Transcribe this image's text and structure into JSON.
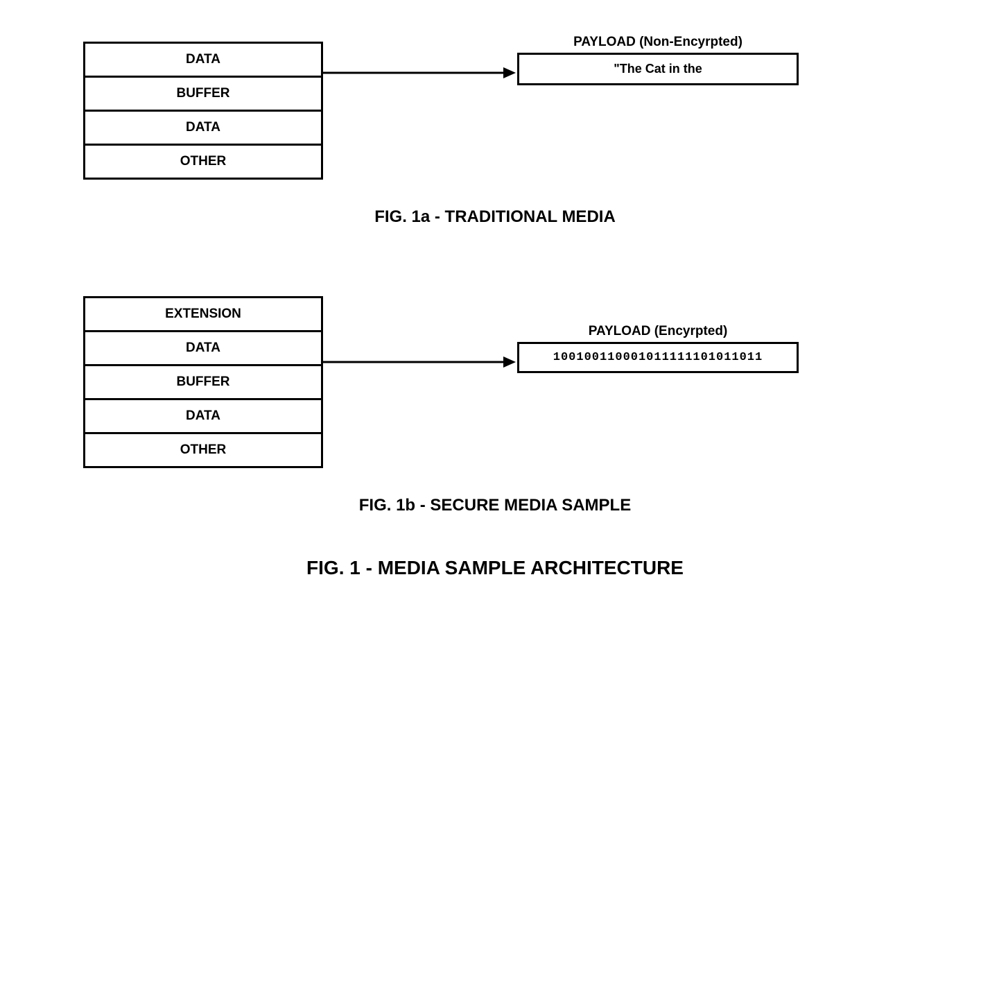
{
  "fig1a": {
    "cells": [
      "DATA",
      "BUFFER",
      "DATA",
      "OTHER"
    ],
    "payload_label": "PAYLOAD (Non-Encyrpted)",
    "payload_text": "\"The Cat in the",
    "caption": "FIG. 1a - TRADITIONAL MEDIA"
  },
  "fig1b": {
    "cells": [
      "EXTENSION",
      "DATA",
      "BUFFER",
      "DATA",
      "OTHER"
    ],
    "payload_label": "PAYLOAD (Encyrpted)",
    "payload_text": "100100110001011111101011011",
    "caption": "FIG. 1b - SECURE MEDIA SAMPLE"
  },
  "main_caption": "FIG. 1 - MEDIA SAMPLE ARCHITECTURE"
}
